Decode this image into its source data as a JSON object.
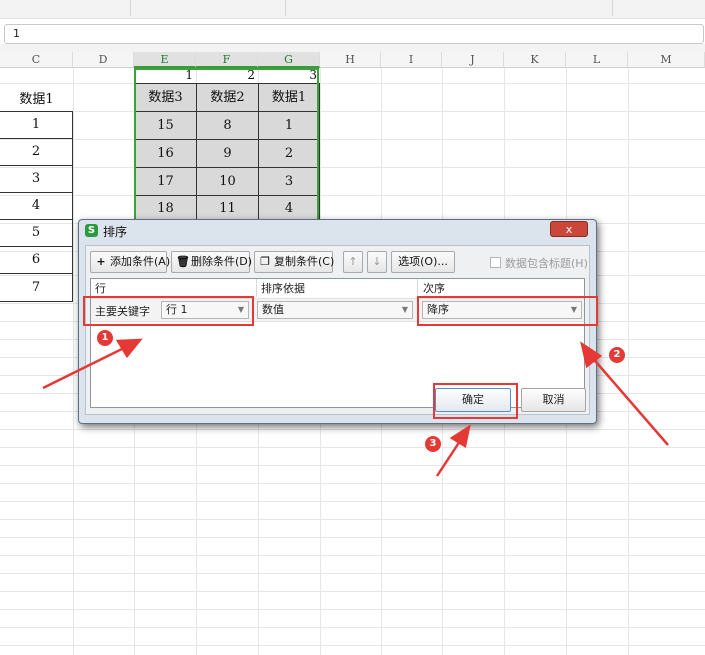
{
  "formula_bar": {
    "value": "1"
  },
  "columns": [
    "C",
    "D",
    "E",
    "F",
    "G",
    "H",
    "I",
    "J",
    "K",
    "L",
    "M"
  ],
  "sheet": {
    "c_header": "数据1",
    "c_values": [
      "1",
      "2",
      "3",
      "4",
      "5",
      "6",
      "7"
    ],
    "row_numbers": [
      "1",
      "2",
      "3"
    ],
    "headers": [
      "数据3",
      "数据2",
      "数据1"
    ],
    "rows": [
      [
        "15",
        "8",
        "1"
      ],
      [
        "16",
        "9",
        "2"
      ],
      [
        "17",
        "10",
        "3"
      ],
      [
        "18",
        "11",
        "4"
      ]
    ]
  },
  "dialog": {
    "title": "排序",
    "close_label": "x",
    "toolbar": {
      "add_condition": "添加条件(A)",
      "delete_condition": "删除条件(D)",
      "copy_condition": "复制条件(C)",
      "move_up": "↑",
      "move_down": "↓",
      "options": "选项(O)...",
      "header_checkbox": "数据包含标题(H)"
    },
    "table": {
      "col_row": "行",
      "col_sort_on": "排序依据",
      "col_order": "次序",
      "primary_key_label": "主要关键字",
      "key_value": "行 1",
      "sort_on_value": "数值",
      "order_value": "降序"
    },
    "ok_label": "确定",
    "cancel_label": "取消"
  },
  "annotations": {
    "badge1": "1",
    "badge2": "2",
    "badge3": "3",
    "color": "#e53935"
  },
  "colors": {
    "selection_green": "#3aa23a",
    "close_red": "#c9483a"
  }
}
